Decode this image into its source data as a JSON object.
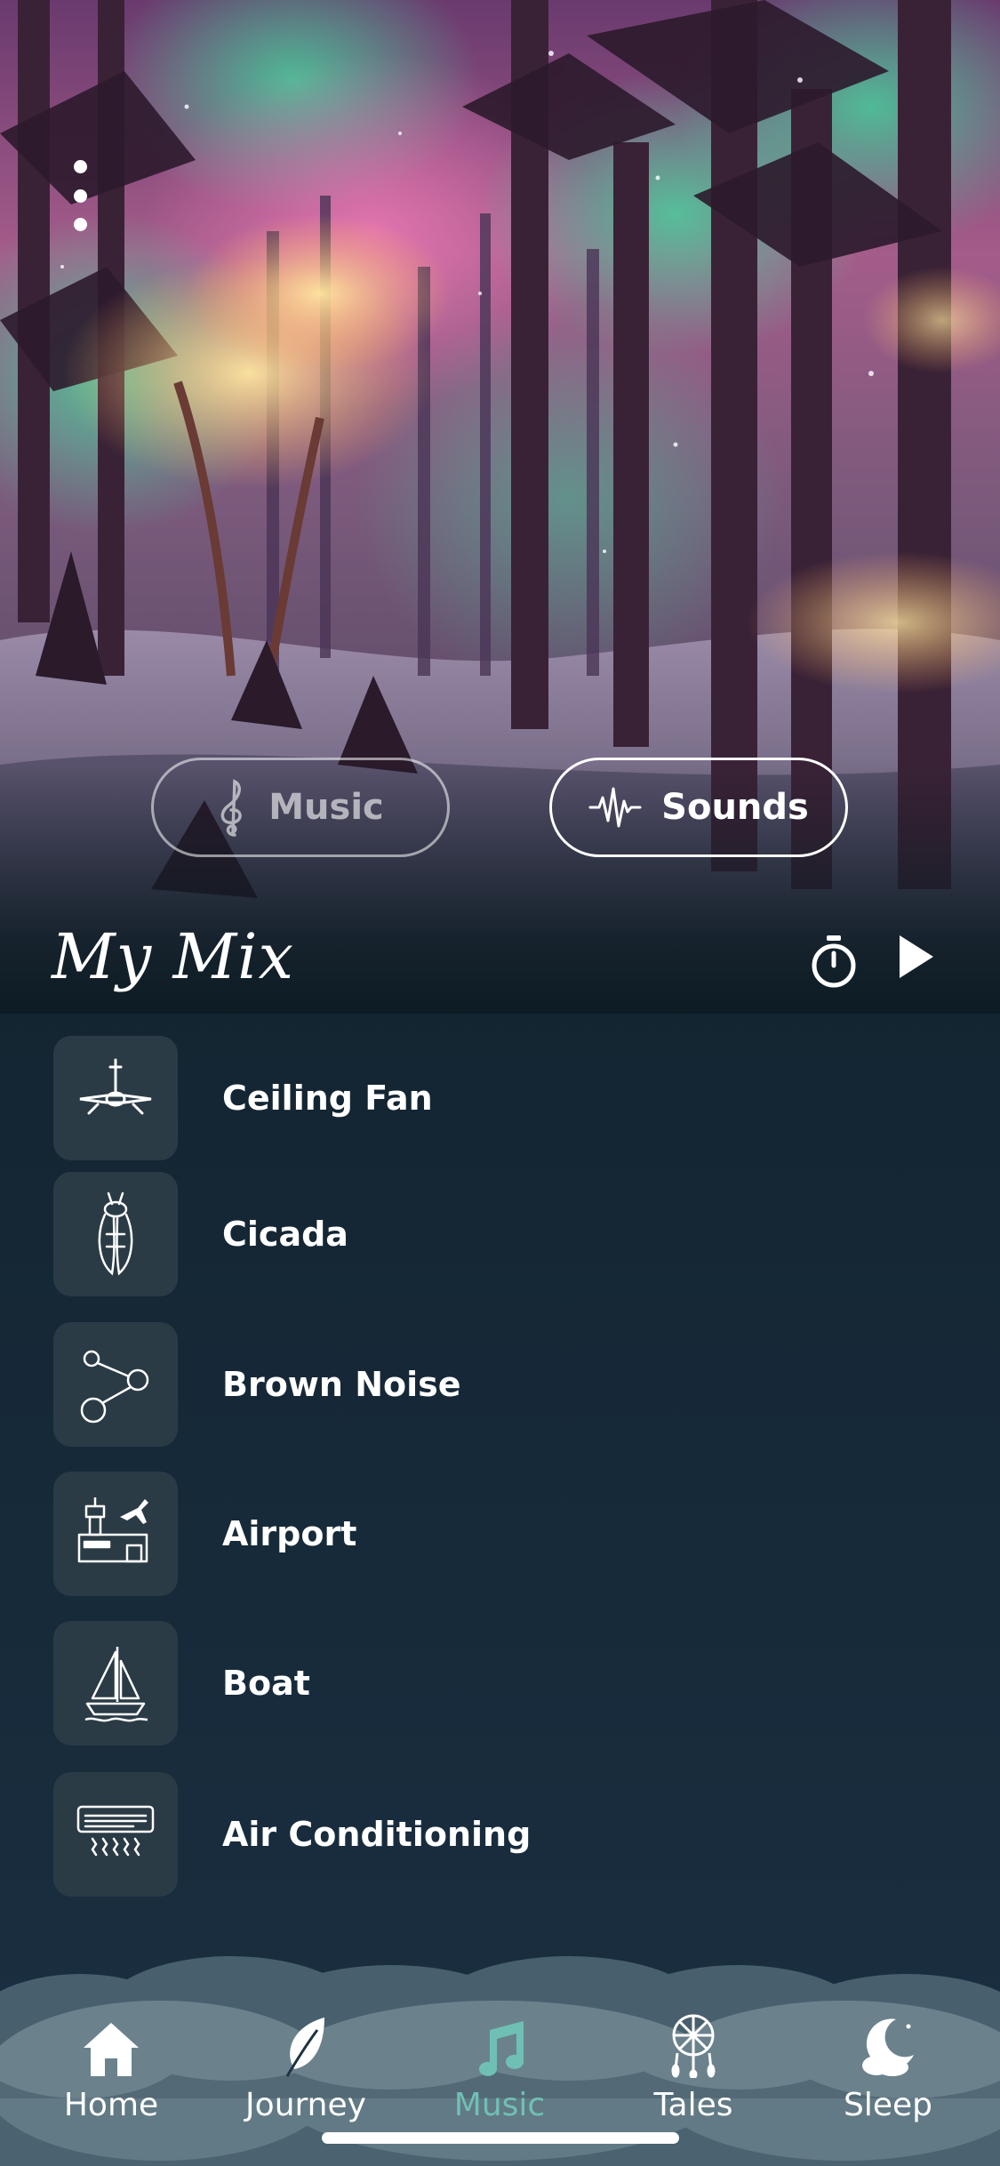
{
  "segments": {
    "music_label": "Music",
    "sounds_label": "Sounds",
    "active": "sounds"
  },
  "mix": {
    "title": "My Mix"
  },
  "sounds": [
    {
      "label": "Ceiling Fan",
      "icon": "ceiling-fan-icon"
    },
    {
      "label": "Cicada",
      "icon": "cicada-icon"
    },
    {
      "label": "Brown Noise",
      "icon": "brown-noise-icon"
    },
    {
      "label": "Airport",
      "icon": "airport-icon"
    },
    {
      "label": "Boat",
      "icon": "boat-icon"
    },
    {
      "label": "Air Conditioning",
      "icon": "air-conditioning-icon"
    }
  ],
  "nav": {
    "active": "Music",
    "items": [
      {
        "label": "Home",
        "icon": "home-icon"
      },
      {
        "label": "Journey",
        "icon": "leaf-icon"
      },
      {
        "label": "Music",
        "icon": "music-note-icon"
      },
      {
        "label": "Tales",
        "icon": "dreamcatcher-icon"
      },
      {
        "label": "Sleep",
        "icon": "moon-cloud-icon"
      }
    ]
  },
  "colors": {
    "accent": "#6fc0b4",
    "background": "#0f1d27",
    "tile": "#2b3b46"
  }
}
